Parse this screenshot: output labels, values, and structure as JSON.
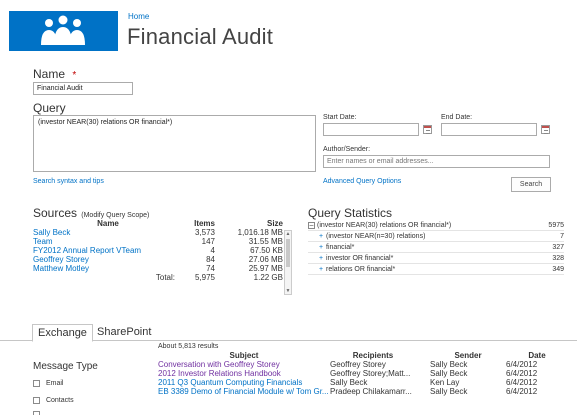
{
  "header": {
    "breadcrumb": "Home",
    "title": "Financial Audit"
  },
  "form": {
    "name_label": "Name",
    "required_marker": "*",
    "name_value": "Financial Audit",
    "query_label": "Query",
    "query_value": "(investor NEAR(30) relations OR financial*)",
    "start_label": "Start Date:",
    "start_value": "",
    "end_label": "End Date:",
    "end_value": "",
    "author_label": "Author/Sender:",
    "author_placeholder": "Enter names or email addresses...",
    "syntax_link": "Search syntax and tips",
    "advanced_link": "Advanced Query Options",
    "search_button": "Search"
  },
  "sources": {
    "title": "Sources",
    "modify_link": "(Modify Query Scope)",
    "columns": {
      "name": "Name",
      "items": "Items",
      "size": "Size"
    },
    "rows": [
      {
        "name": "Sally Beck",
        "items": "3,573",
        "size": "1,016.18 MB"
      },
      {
        "name": "Team",
        "items": "147",
        "size": "31.55 MB"
      },
      {
        "name": "FY2012 Annual Report VTeam",
        "items": "4",
        "size": "67.50 KB"
      },
      {
        "name": "Geoffrey Storey",
        "items": "84",
        "size": "27.06 MB"
      },
      {
        "name": "Matthew Motley",
        "items": "74",
        "size": "25.97 MB"
      }
    ],
    "total_label": "Total:",
    "total_items": "5,975",
    "total_size": "1.22 GB"
  },
  "stats": {
    "title": "Query Statistics",
    "root": {
      "toggle": "–",
      "text": "(investor NEAR(30) relations OR financial*)",
      "count": "5975"
    },
    "rows": [
      {
        "toggle": "+",
        "text": "(investor NEAR(n=30) relations)",
        "count": "7"
      },
      {
        "toggle": "+",
        "text": "financial*",
        "count": "327"
      },
      {
        "toggle": "+",
        "text": "investor OR financial*",
        "count": "328"
      },
      {
        "toggle": "+",
        "text": "relations OR financial*",
        "count": "349"
      }
    ]
  },
  "tabs": [
    {
      "label": "Exchange"
    },
    {
      "label": "SharePoint"
    }
  ],
  "refine": {
    "title": "Message Type",
    "options": [
      {
        "label": "Email"
      },
      {
        "label": "Contacts"
      }
    ]
  },
  "results": {
    "summary": "About 5,813 results",
    "columns": {
      "subject": "Subject",
      "recipients": "Recipients",
      "sender": "Sender",
      "date": "Date"
    },
    "rows": [
      {
        "subject": "Conversation with Geoffrey Storey",
        "recipients": "Geoffrey Storey",
        "sender": "Sally Beck",
        "date": "6/4/2012",
        "color": "#7030a0"
      },
      {
        "subject": "2012 Investor Relations Handbook",
        "recipients": "Geoffrey Storey;Matt...",
        "sender": "Sally Beck",
        "date": "6/4/2012",
        "color": "#7030a0"
      },
      {
        "subject": "2011 Q3 Quantum Computing Financials",
        "recipients": "Sally Beck",
        "sender": "Ken Lay",
        "date": "6/4/2012",
        "color": "#0072c6"
      },
      {
        "subject": "EB 3389 Demo of Financial Module w/ Tom Gr...",
        "recipients": "Pradeep Chilakamarr...",
        "sender": "Sally Beck",
        "date": "6/4/2012",
        "color": "#0072c6"
      }
    ]
  },
  "colors": {
    "accent": "#0072c6",
    "visited": "#7030a0",
    "required": "#bf0000"
  }
}
